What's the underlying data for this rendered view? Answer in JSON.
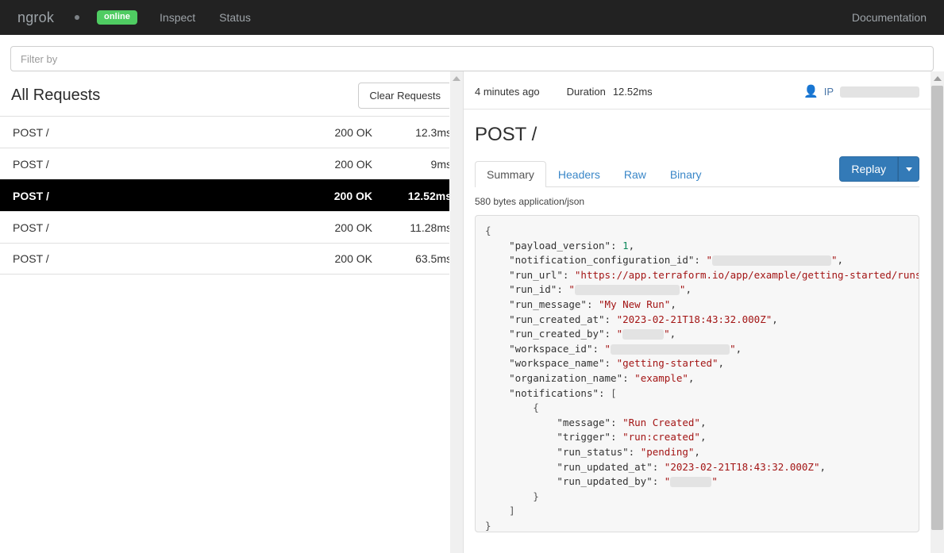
{
  "navbar": {
    "brand": "ngrok",
    "status_dot_icon": "dot-icon",
    "badge": "online",
    "links": [
      {
        "label": "Inspect",
        "name": "nav-link-inspect"
      },
      {
        "label": "Status",
        "name": "nav-link-status"
      }
    ],
    "documentation": "Documentation"
  },
  "filter": {
    "placeholder": "Filter by",
    "value": ""
  },
  "requests_panel": {
    "title": "All Requests",
    "clear_label": "Clear Requests",
    "columns": [
      "method_path",
      "status",
      "duration"
    ],
    "rows": [
      {
        "method": "POST /",
        "status": "200 OK",
        "duration": "12.3ms",
        "selected": false
      },
      {
        "method": "POST /",
        "status": "200 OK",
        "duration": "9ms",
        "selected": false
      },
      {
        "method": "POST /",
        "status": "200 OK",
        "duration": "12.52ms",
        "selected": true
      },
      {
        "method": "POST /",
        "status": "200 OK",
        "duration": "11.28ms",
        "selected": false
      },
      {
        "method": "POST /",
        "status": "200 OK",
        "duration": "63.5ms",
        "selected": false
      }
    ]
  },
  "detail": {
    "time_ago": "4 minutes ago",
    "duration_label": "Duration",
    "duration_value": "12.52ms",
    "person_icon": "person-icon",
    "ip_label": "IP",
    "ip_value": "",
    "title": "POST /",
    "tabs": [
      {
        "label": "Summary",
        "active": true
      },
      {
        "label": "Headers",
        "active": false
      },
      {
        "label": "Raw",
        "active": false
      },
      {
        "label": "Binary",
        "active": false
      }
    ],
    "replay_label": "Replay",
    "replay_caret_icon": "chevron-down-icon",
    "bytes_line": "580 bytes application/json",
    "body": {
      "lines": [
        {
          "indent": 0,
          "text": "{"
        },
        {
          "indent": 1,
          "key": "payload_version",
          "value": "1",
          "kind": "number"
        },
        {
          "indent": 1,
          "key": "notification_configuration_id",
          "value": "",
          "kind": "redacted",
          "redact_width": 150
        },
        {
          "indent": 1,
          "key": "run_url",
          "value": "https://app.terraform.io/app/example/getting-started/runs/",
          "kind": "string"
        },
        {
          "indent": 1,
          "key": "run_id",
          "value": "",
          "kind": "redacted",
          "redact_width": 132
        },
        {
          "indent": 1,
          "key": "run_message",
          "value": "My New Run",
          "kind": "string"
        },
        {
          "indent": 1,
          "key": "run_created_at",
          "value": "2023-02-21T18:43:32.000Z",
          "kind": "string"
        },
        {
          "indent": 1,
          "key": "run_created_by",
          "value": "",
          "kind": "redacted",
          "redact_width": 52
        },
        {
          "indent": 1,
          "key": "workspace_id",
          "value": "",
          "kind": "redacted",
          "redact_width": 150
        },
        {
          "indent": 1,
          "key": "workspace_name",
          "value": "getting-started",
          "kind": "string"
        },
        {
          "indent": 1,
          "key": "organization_name",
          "value": "example",
          "kind": "string"
        },
        {
          "indent": 1,
          "key": "notifications",
          "value": "[",
          "kind": "open"
        },
        {
          "indent": 2,
          "text": "{"
        },
        {
          "indent": 3,
          "key": "message",
          "value": "Run Created",
          "kind": "string"
        },
        {
          "indent": 3,
          "key": "trigger",
          "value": "run:created",
          "kind": "string"
        },
        {
          "indent": 3,
          "key": "run_status",
          "value": "pending",
          "kind": "string"
        },
        {
          "indent": 3,
          "key": "run_updated_at",
          "value": "2023-02-21T18:43:32.000Z",
          "kind": "string"
        },
        {
          "indent": 3,
          "key": "run_updated_by",
          "value": "",
          "kind": "redacted",
          "redact_width": 52,
          "last": true
        },
        {
          "indent": 2,
          "text": "}"
        },
        {
          "indent": 1,
          "text": "]"
        },
        {
          "indent": 0,
          "text": "}"
        }
      ]
    }
  },
  "scrollbars": {
    "left_arrow_icon": "caret-up-icon",
    "right_arrow_icon": "caret-up-icon"
  },
  "colors": {
    "nav_bg": "#222222",
    "online_badge": "#4fcc62",
    "replay_blue": "#337ab7",
    "selected_row": "#000000",
    "redaction": "#e3e3e3",
    "json_string": "#a31515",
    "json_number": "#098658"
  }
}
